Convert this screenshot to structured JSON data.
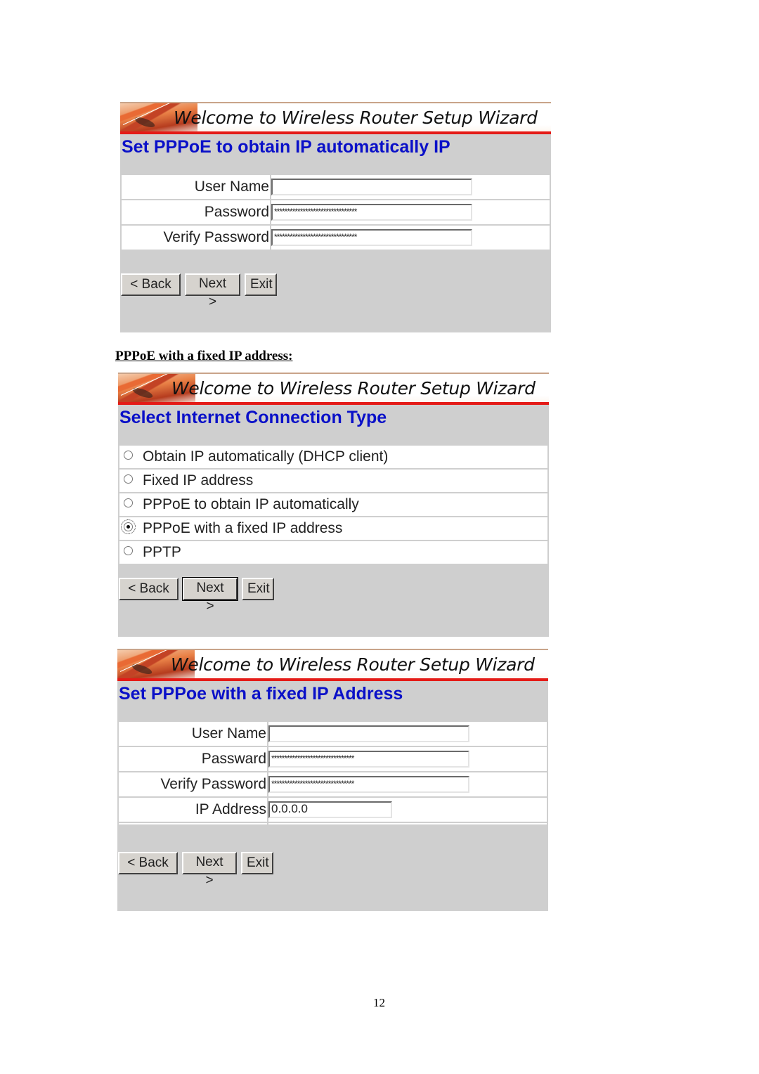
{
  "banner_title": "Welcome to Wireless Router Setup Wizard",
  "colors": {
    "subtitle_blue": "#0a10c8",
    "banner_red": "#e41b17",
    "panel_gray": "#cfcfcf"
  },
  "panel1": {
    "subtitle": "Set PPPoE to obtain IP automatically IP",
    "fields": [
      {
        "label": "User Name",
        "value": ""
      },
      {
        "label": "Password",
        "value": "********************************"
      },
      {
        "label": "Verify Password",
        "value": "********************************"
      }
    ],
    "buttons": {
      "back": "< Back",
      "next": "Next >",
      "exit": "Exit"
    }
  },
  "caption": "PPPoE with a fixed IP address:",
  "panel2": {
    "subtitle": "Select Internet Connection Type",
    "options": [
      {
        "label": "Obtain IP automatically (DHCP client)",
        "checked": false
      },
      {
        "label": "Fixed IP address",
        "checked": false
      },
      {
        "label": "PPPoE to obtain IP automatically",
        "checked": false
      },
      {
        "label": "PPPoE with a fixed IP address",
        "checked": true
      },
      {
        "label": "PPTP",
        "checked": false
      }
    ],
    "buttons": {
      "back": "< Back",
      "next": "Next >",
      "exit": "Exit"
    }
  },
  "panel3": {
    "subtitle": "Set PPPoe with a fixed IP Address",
    "fields": [
      {
        "label": "User Name",
        "value": ""
      },
      {
        "label": "Passward",
        "value": "********************************"
      },
      {
        "label": "Verify Password",
        "value": "********************************"
      },
      {
        "label": "IP Address",
        "value": "0.0.0.0"
      }
    ],
    "buttons": {
      "back": "< Back",
      "next": "Next >",
      "exit": "Exit"
    }
  },
  "page_number": "12"
}
